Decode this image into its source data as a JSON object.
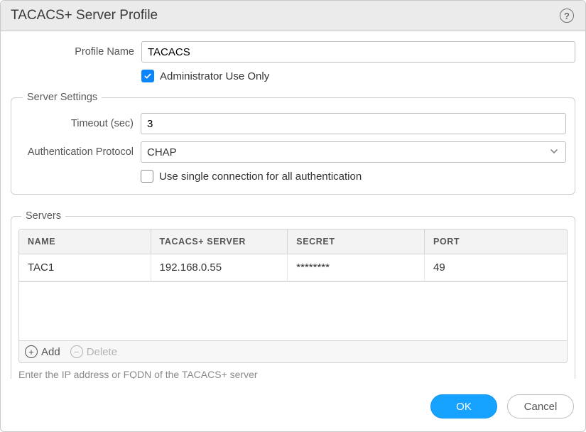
{
  "dialog": {
    "title": "TACACS+ Server Profile"
  },
  "profile": {
    "name_label": "Profile Name",
    "name_value": "TACACS",
    "admin_only_label": "Administrator Use Only",
    "admin_only_checked": true
  },
  "server_settings": {
    "legend": "Server Settings",
    "timeout_label": "Timeout (sec)",
    "timeout_value": "3",
    "auth_protocol_label": "Authentication Protocol",
    "auth_protocol_value": "CHAP",
    "single_conn_label": "Use single connection for all authentication",
    "single_conn_checked": false
  },
  "servers": {
    "legend": "Servers",
    "columns": {
      "name": "NAME",
      "server": "TACACS+ SERVER",
      "secret": "SECRET",
      "port": "PORT"
    },
    "rows": [
      {
        "name": "TAC1",
        "server": "192.168.0.55",
        "secret": "********",
        "port": "49"
      }
    ],
    "add_label": "Add",
    "delete_label": "Delete",
    "help_text": "Enter the IP address or FQDN of the TACACS+ server"
  },
  "footer": {
    "ok": "OK",
    "cancel": "Cancel"
  }
}
